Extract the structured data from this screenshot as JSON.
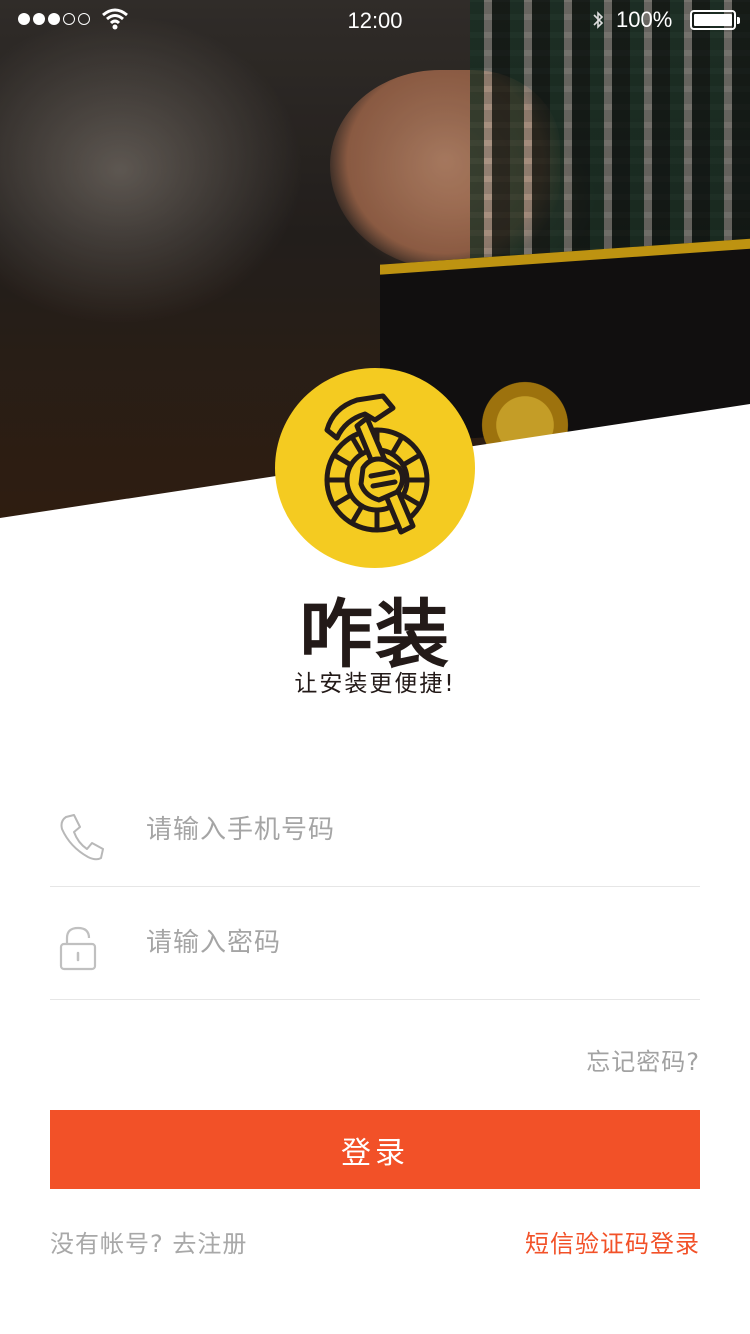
{
  "status_bar": {
    "time": "12:00",
    "battery_text": "100%",
    "signal_dots": [
      true,
      true,
      true,
      false,
      false
    ]
  },
  "brand": {
    "name": "咋装",
    "slogan": "让安装更便捷!",
    "logo_color": "#f4cb21"
  },
  "form": {
    "phone": {
      "placeholder": "请输入手机号码",
      "value": "",
      "icon": "phone-icon"
    },
    "password": {
      "placeholder": "请输入密码",
      "value": "",
      "icon": "lock-icon"
    },
    "forgot_label": "忘记密码?",
    "login_label": "登录"
  },
  "footer": {
    "register_label": "没有帐号? 去注册",
    "sms_login_label": "短信验证码登录"
  },
  "colors": {
    "accent": "#f25128",
    "text_dark": "#231a18",
    "placeholder": "#a5a5a5"
  }
}
